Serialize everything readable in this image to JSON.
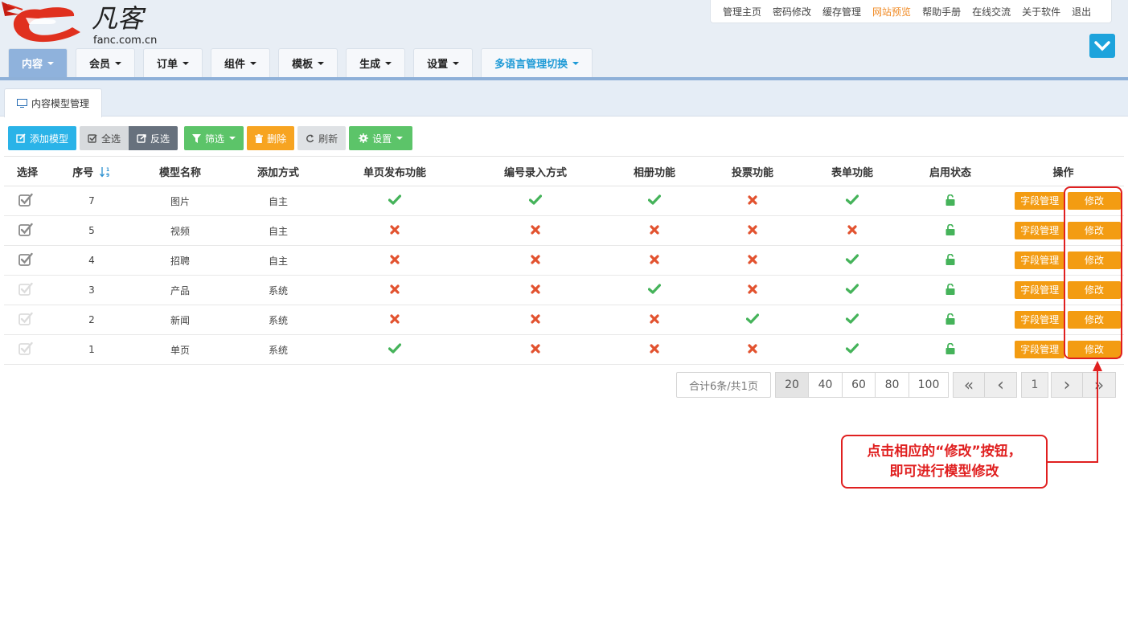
{
  "brand": {
    "logo_text": "凡客",
    "logo_domain": "fanc.com.cn"
  },
  "top_links": [
    "管理主页",
    "密码修改",
    "缓存管理",
    "网站预览",
    "帮助手册",
    "在线交流",
    "关于软件",
    "退出"
  ],
  "top_links_active": "网站预览",
  "nav": [
    "内容",
    "会员",
    "订单",
    "组件",
    "模板",
    "生成",
    "设置",
    "多语言管理切换"
  ],
  "tab": {
    "label": "内容模型管理"
  },
  "toolbar": {
    "add": "添加模型",
    "select_all": "全选",
    "invert": "反选",
    "filter": "筛选",
    "delete": "删除",
    "refresh": "刷新",
    "settings": "设置"
  },
  "columns": [
    "选择",
    "序号",
    "模型名称",
    "添加方式",
    "单页发布功能",
    "编号录入方式",
    "相册功能",
    "投票功能",
    "表单功能",
    "启用状态",
    "操作"
  ],
  "rows": [
    {
      "id": "7",
      "name": "图片",
      "source": "自主",
      "single": true,
      "numbering": true,
      "album": true,
      "vote": false,
      "form": true,
      "checked": true
    },
    {
      "id": "5",
      "name": "视频",
      "source": "自主",
      "single": false,
      "numbering": false,
      "album": false,
      "vote": false,
      "form": false,
      "checked": true
    },
    {
      "id": "4",
      "name": "招聘",
      "source": "自主",
      "single": false,
      "numbering": false,
      "album": false,
      "vote": false,
      "form": true,
      "checked": true
    },
    {
      "id": "3",
      "name": "产品",
      "source": "系统",
      "single": false,
      "numbering": false,
      "album": true,
      "vote": false,
      "form": true,
      "checked": false
    },
    {
      "id": "2",
      "name": "新闻",
      "source": "系统",
      "single": false,
      "numbering": false,
      "album": false,
      "vote": true,
      "form": true,
      "checked": false
    },
    {
      "id": "1",
      "name": "单页",
      "source": "系统",
      "single": true,
      "numbering": false,
      "album": false,
      "vote": false,
      "form": true,
      "checked": false
    }
  ],
  "actions": {
    "fields": "字段管理",
    "edit": "修改"
  },
  "pagination": {
    "info": "合计6条/共1页",
    "sizes": [
      "20",
      "40",
      "60",
      "80",
      "100"
    ],
    "first": "«",
    "prev": "‹",
    "current": "1",
    "next": "›",
    "last": "»"
  },
  "annotation": {
    "line1": "点击相应的“修改”按钮，",
    "line2": "即可进行模型修改"
  },
  "colors": {
    "accent": "#1da3dc",
    "check": "#45b35a",
    "cross": "#e2522f",
    "action": "#f39c12",
    "annotation": "#e02020"
  }
}
